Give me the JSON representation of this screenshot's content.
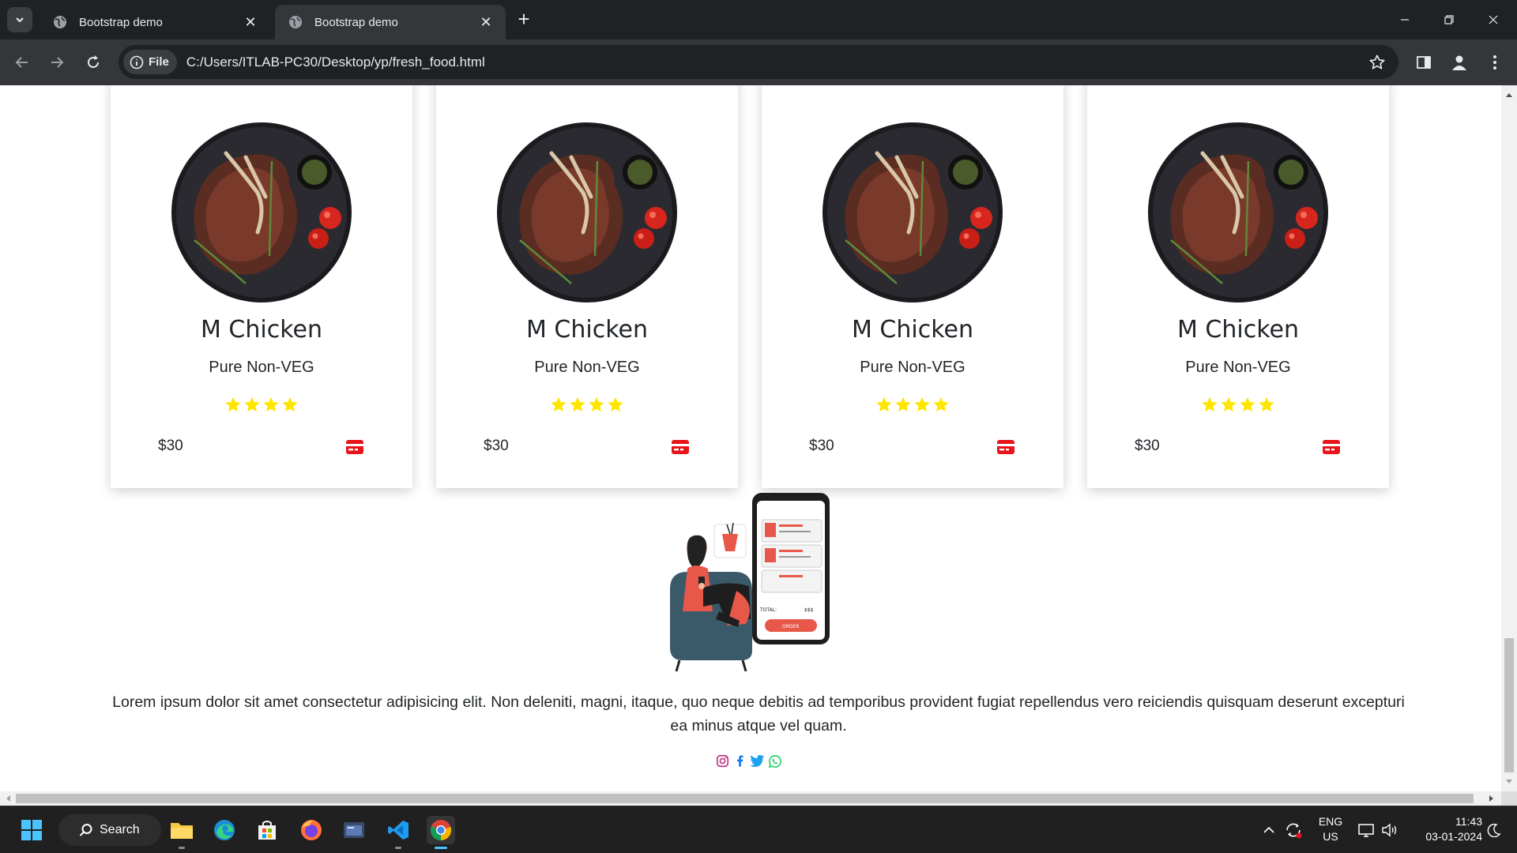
{
  "browser": {
    "tabs": [
      {
        "title": "Bootstrap demo",
        "active": false
      },
      {
        "title": "Bootstrap demo",
        "active": true
      }
    ],
    "address": {
      "chip_label": "File",
      "url": "C:/Users/ITLAB-PC30/Desktop/yp/fresh_food.html"
    }
  },
  "products": [
    {
      "name": "M Chicken",
      "category": "Pure Non-VEG",
      "rating": 4,
      "price": "$30"
    },
    {
      "name": "M Chicken",
      "category": "Pure Non-VEG",
      "rating": 4,
      "price": "$30"
    },
    {
      "name": "M Chicken",
      "category": "Pure Non-VEG",
      "rating": 4,
      "price": "$30"
    },
    {
      "name": "M Chicken",
      "category": "Pure Non-VEG",
      "rating": 4,
      "price": "$30"
    }
  ],
  "footer": {
    "description": "Lorem ipsum dolor sit amet consectetur adipisicing elit. Non deleniti, magni, itaque, quo neque debitis ad temporibus provident fugiat repellendus vero reiciendis quisquam deserunt excepturi ea minus atque vel quam.",
    "socials": [
      "instagram-icon",
      "facebook-icon",
      "twitter-icon",
      "whatsapp-icon"
    ],
    "illustration_text": {
      "total": "TOTAL:",
      "amount": "$$$",
      "order": "ORDER"
    }
  },
  "taskbar": {
    "search_label": "Search",
    "language": "ENG",
    "region": "US",
    "time": "11:43",
    "date": "03-01-2024"
  },
  "colors": {
    "star": "#ffe600",
    "cart": "#e8141b",
    "instagram": "#c13584",
    "facebook": "#1877f2",
    "twitter": "#1da1f2",
    "whatsapp": "#25d366"
  }
}
